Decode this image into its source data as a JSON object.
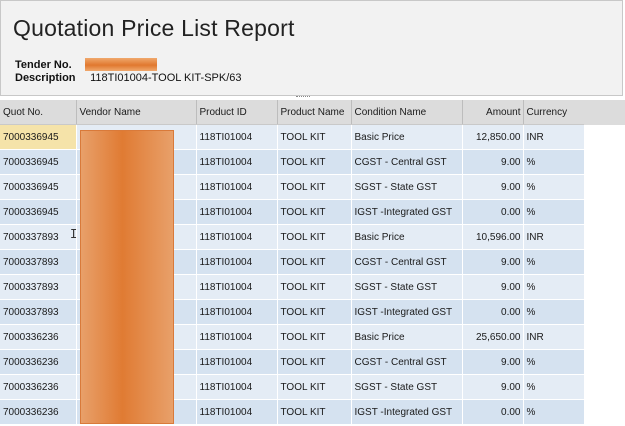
{
  "report": {
    "title": "Quotation Price List Report",
    "tender_label": "Tender No.",
    "description_label": "Description",
    "description_value": "118TI01004-TOOL KIT-SPK/63"
  },
  "table": {
    "columns": [
      "Quot No.",
      "Vendor Name",
      "Product ID",
      "Product Name",
      "Condition Name",
      "Amount",
      "Currency"
    ],
    "rows": [
      {
        "quot_no": "7000336945",
        "product_id": "118TI01004",
        "product_name": "TOOL KIT",
        "condition": "Basic Price",
        "amount": "12,850.00",
        "currency": "INR"
      },
      {
        "quot_no": "7000336945",
        "product_id": "118TI01004",
        "product_name": "TOOL KIT",
        "condition": "CGST - Central GST",
        "amount": "9.00",
        "currency": "%"
      },
      {
        "quot_no": "7000336945",
        "product_id": "118TI01004",
        "product_name": "TOOL KIT",
        "condition": "SGST - State GST",
        "amount": "9.00",
        "currency": "%"
      },
      {
        "quot_no": "7000336945",
        "product_id": "118TI01004",
        "product_name": "TOOL KIT",
        "condition": "IGST -Integrated GST",
        "amount": "0.00",
        "currency": "%"
      },
      {
        "quot_no": "7000337893",
        "product_id": "118TI01004",
        "product_name": "TOOL KIT",
        "condition": "Basic Price",
        "amount": "10,596.00",
        "currency": "INR"
      },
      {
        "quot_no": "7000337893",
        "product_id": "118TI01004",
        "product_name": "TOOL KIT",
        "condition": "CGST - Central GST",
        "amount": "9.00",
        "currency": "%"
      },
      {
        "quot_no": "7000337893",
        "product_id": "118TI01004",
        "product_name": "TOOL KIT",
        "condition": "SGST - State GST",
        "amount": "9.00",
        "currency": "%"
      },
      {
        "quot_no": "7000337893",
        "product_id": "118TI01004",
        "product_name": "TOOL KIT",
        "condition": "IGST -Integrated GST",
        "amount": "0.00",
        "currency": "%"
      },
      {
        "quot_no": "7000336236",
        "product_id": "118TI01004",
        "product_name": "TOOL KIT",
        "condition": "Basic Price",
        "amount": "25,650.00",
        "currency": "INR"
      },
      {
        "quot_no": "7000336236",
        "product_id": "118TI01004",
        "product_name": "TOOL KIT",
        "condition": "CGST - Central GST",
        "amount": "9.00",
        "currency": "%"
      },
      {
        "quot_no": "7000336236",
        "product_id": "118TI01004",
        "product_name": "TOOL KIT",
        "condition": "SGST - State GST",
        "amount": "9.00",
        "currency": "%"
      },
      {
        "quot_no": "7000336236",
        "product_id": "118TI01004",
        "product_name": "TOOL KIT",
        "condition": "IGST -Integrated GST",
        "amount": "0.00",
        "currency": "%"
      }
    ]
  },
  "colors": {
    "row_odd": "#e4ecf5",
    "row_even": "#d5e2f0",
    "selected_cell": "#f5e3a9",
    "redaction": "#e07b33"
  },
  "icons": [
    "text-cursor-icon"
  ]
}
